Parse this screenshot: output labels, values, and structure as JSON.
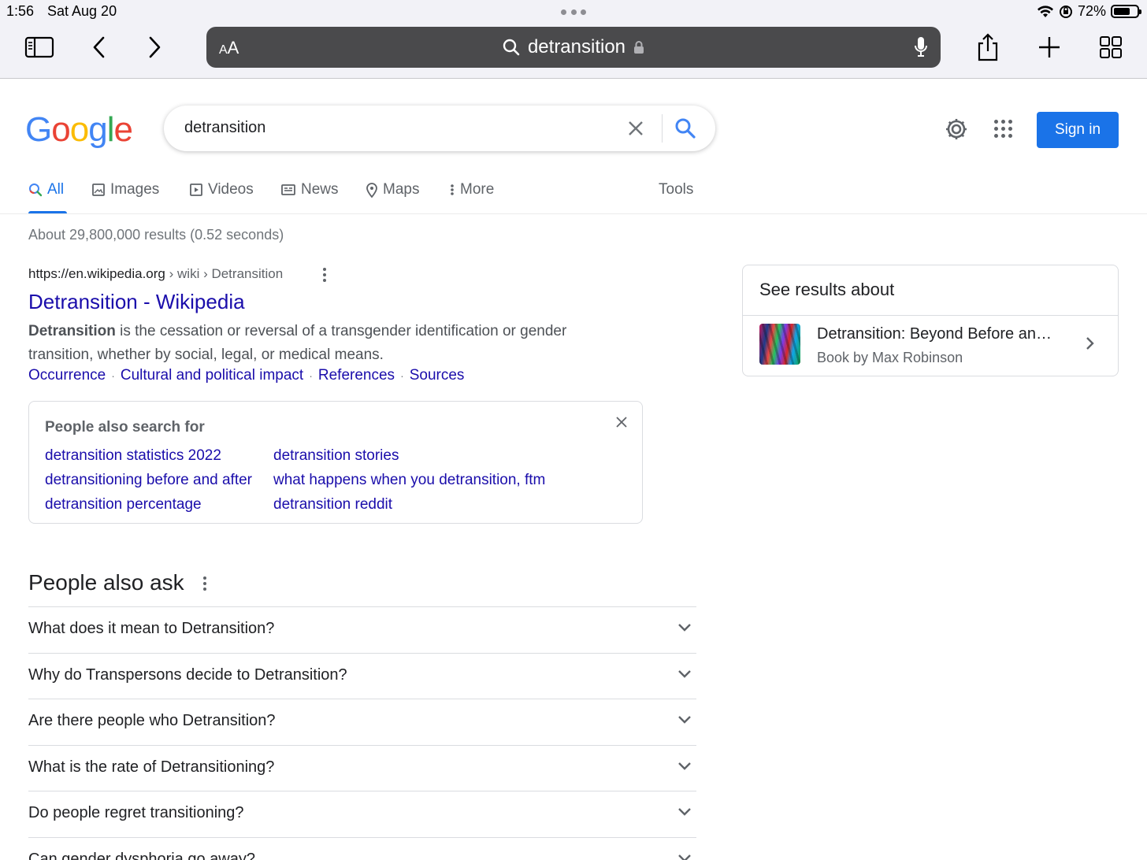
{
  "status_bar": {
    "time": "1:56",
    "date": "Sat Aug 20",
    "battery": "72%",
    "battery_level": 0.72
  },
  "safari": {
    "aa_label": "AA",
    "address_text": "detransition",
    "icons": [
      "sidebar-icon",
      "back-icon",
      "forward-icon",
      "search-icon",
      "lock-icon",
      "mic-icon",
      "share-icon",
      "new-tab-icon",
      "tabs-overview-icon"
    ]
  },
  "google": {
    "logo_letters": [
      "G",
      "o",
      "o",
      "g",
      "l",
      "e"
    ],
    "search_query": "detransition",
    "sign_in_label": "Sign in",
    "accent": "#1a73e8",
    "link_color": "#1a0dab"
  },
  "tabs": {
    "all": "All",
    "images": "Images",
    "videos": "Videos",
    "news": "News",
    "maps": "Maps",
    "more": "More",
    "tools": "Tools"
  },
  "result_stats": "About 29,800,000 results (0.52 seconds)",
  "result": {
    "url_host": "https://en.wikipedia.org",
    "url_path": "› wiki › Detransition",
    "title": "Detransition - Wikipedia",
    "snippet_bold": "Detransition",
    "snippet_line1": " is the cessation or reversal of a transgender identification or gender",
    "snippet_line2": "transition, whether by social, legal, or medical means.",
    "sitelinks": [
      "Occurrence",
      "Cultural and political impact",
      "References",
      "Sources"
    ]
  },
  "people_also_search": {
    "title": "People also search for",
    "links": [
      "detransition statistics 2022",
      "detransition stories",
      "detransitioning before and after",
      "what happens when you detransition, ftm",
      "detransition percentage",
      "detransition reddit"
    ]
  },
  "people_also_ask": {
    "title": "People also ask",
    "questions": [
      "What does it mean to Detransition?",
      "Why do Transpersons decide to Detransition?",
      "Are there people who Detransition?",
      "What is the rate of Detransitioning?",
      "Do people regret transitioning?",
      "Can gender dysphoria go away?"
    ]
  },
  "side_panel": {
    "title": "See results about",
    "item_title": "Detransition: Beyond Before an…",
    "item_subtitle": "Book by Max Robinson"
  }
}
